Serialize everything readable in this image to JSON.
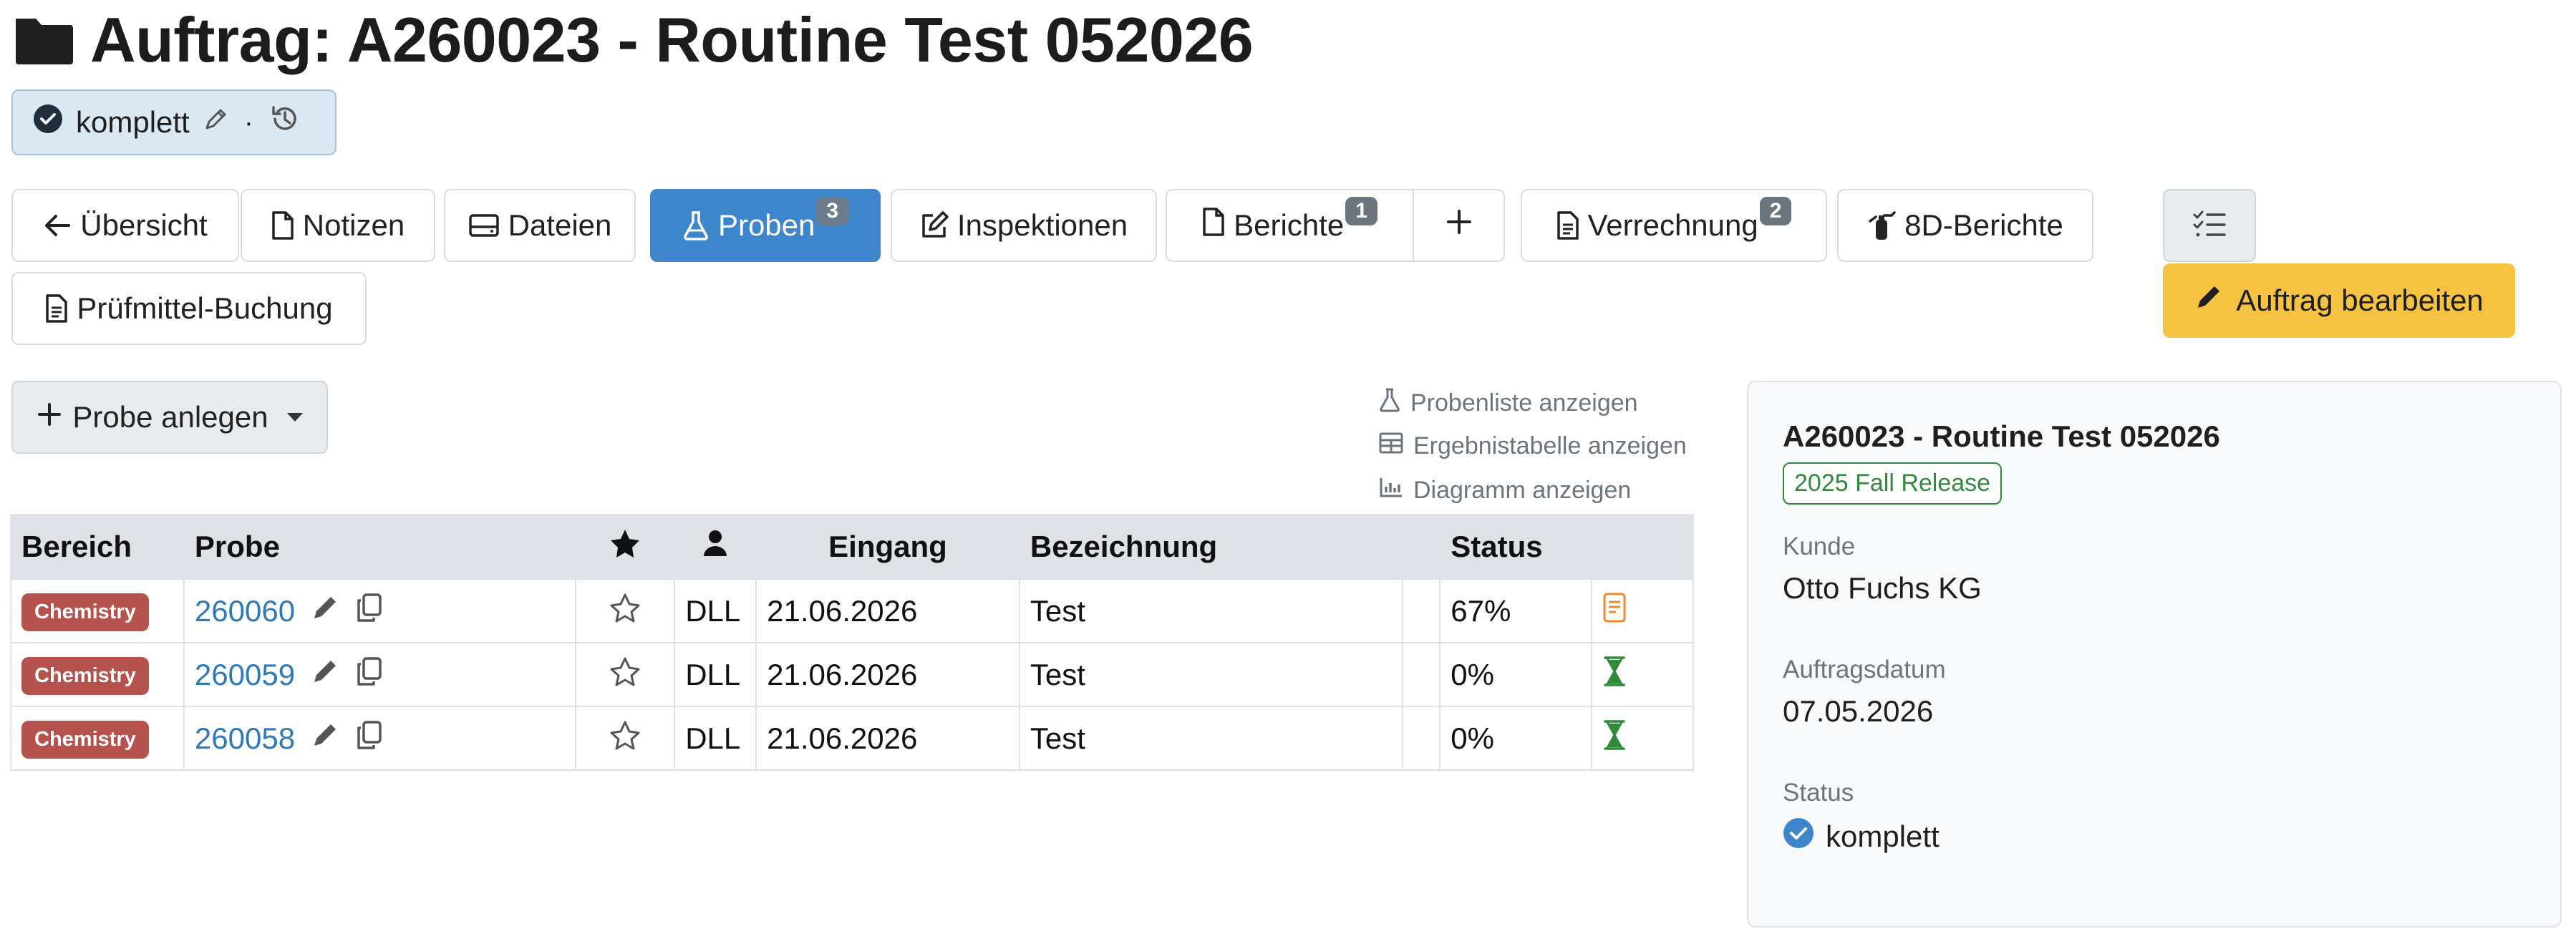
{
  "header": {
    "title": "Auftrag: A260023 - Routine Test 052026",
    "folder_icon": "folder-icon"
  },
  "status_pill": {
    "label": "komplett",
    "separator": "·",
    "icons": [
      "check-circle-icon",
      "pencil-icon",
      "history-icon"
    ]
  },
  "tabs": [
    {
      "id": "uebersicht",
      "label": "Übersicht",
      "icon": "arrow-left-icon",
      "badge": ""
    },
    {
      "id": "notizen",
      "label": "Notizen",
      "icon": "file-icon",
      "badge": ""
    },
    {
      "id": "dateien",
      "label": "Dateien",
      "icon": "hdd-icon",
      "badge": ""
    },
    {
      "id": "proben",
      "label": "Proben",
      "icon": "flask-icon",
      "badge": "3",
      "active": true
    },
    {
      "id": "inspektionen",
      "label": "Inspektionen",
      "icon": "edit-icon",
      "badge": ""
    },
    {
      "id": "berichte",
      "label": "Berichte",
      "icon": "file-icon",
      "badge": "1"
    },
    {
      "id": "add",
      "label": "+",
      "icon": "plus-icon",
      "badge": ""
    },
    {
      "id": "verrechnung",
      "label": "Verrechnung",
      "icon": "file-text-icon",
      "badge": "2"
    },
    {
      "id": "8d",
      "label": "8D-Berichte",
      "icon": "extinguisher-icon",
      "badge": ""
    },
    {
      "id": "pruefmittel",
      "label": "Prüfmittel-Buchung",
      "icon": "file-text-icon",
      "badge": ""
    }
  ],
  "actions": {
    "edit_label": "Auftrag bearbeiten",
    "probe_label": "Probe anlegen"
  },
  "view_links": [
    {
      "label": "Probenliste anzeigen",
      "icon": "flask-icon"
    },
    {
      "label": "Ergebnistabelle anzeigen",
      "icon": "table-icon"
    },
    {
      "label": "Diagramm anzeigen",
      "icon": "bar-chart-icon"
    }
  ],
  "table": {
    "headers": {
      "bereich": "Bereich",
      "probe": "Probe",
      "eingang": "Eingang",
      "bezeichnung": "Bezeichnung",
      "status": "Status"
    },
    "rows": [
      {
        "bereich": "Chemistry",
        "probe": "260060",
        "user": "DLL",
        "eingang": "21.06.2026",
        "bezeichnung": "Test",
        "status": "67%",
        "status_icon": "report-icon"
      },
      {
        "bereich": "Chemistry",
        "probe": "260059",
        "user": "DLL",
        "eingang": "21.06.2026",
        "bezeichnung": "Test",
        "status": "0%",
        "status_icon": "hourglass-icon"
      },
      {
        "bereich": "Chemistry",
        "probe": "260058",
        "user": "DLL",
        "eingang": "21.06.2026",
        "bezeichnung": "Test",
        "status": "0%",
        "status_icon": "hourglass-icon"
      }
    ]
  },
  "panel": {
    "title": "A260023 - Routine Test 052026",
    "release": "2025 Fall Release",
    "kunde_label": "Kunde",
    "kunde": "Otto Fuchs KG",
    "datum_label": "Auftragsdatum",
    "datum": "07.05.2026",
    "status_label": "Status",
    "status": "komplett"
  },
  "colors": {
    "primary": "#3d86cc",
    "warning": "#f5c242",
    "chemistry": "#b5524d",
    "success": "#2f8a3a",
    "link": "#2e7ab8"
  }
}
